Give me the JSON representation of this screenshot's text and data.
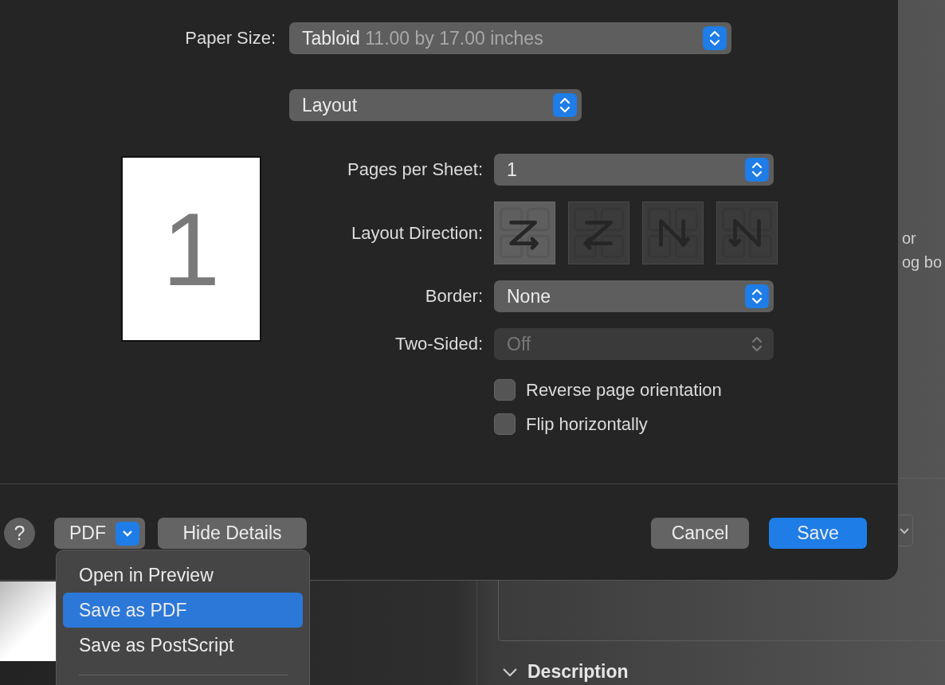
{
  "background_window": {
    "text_lines": [
      "or",
      "og bo"
    ],
    "section": {
      "label": "Description",
      "expanded": true
    }
  },
  "dialog": {
    "paper_size": {
      "label": "Paper Size:",
      "value": "Tabloid",
      "detail": "11.00 by 17.00 inches"
    },
    "section_popup": {
      "value": "Layout"
    },
    "preview": {
      "page_number": "1"
    },
    "fields": [
      {
        "kind": "popup",
        "label": "Pages per Sheet:",
        "value": "1",
        "disabled": false
      },
      {
        "kind": "direction",
        "label": "Layout Direction:",
        "options": [
          {
            "kind": "z",
            "selected": true
          },
          {
            "kind": "reverse-z",
            "selected": false
          },
          {
            "kind": "reverse-n",
            "selected": false
          },
          {
            "kind": "n",
            "selected": false
          }
        ]
      },
      {
        "kind": "popup",
        "label": "Border:",
        "value": "None",
        "disabled": false
      },
      {
        "kind": "popup",
        "label": "Two-Sided:",
        "value": "Off",
        "disabled": true
      }
    ],
    "checkboxes": [
      {
        "label": "Reverse page orientation",
        "checked": false
      },
      {
        "label": "Flip horizontally",
        "checked": false
      }
    ],
    "footer": {
      "help": "?",
      "pdf": "PDF",
      "hide_details": "Hide Details",
      "cancel": "Cancel",
      "save": "Save"
    },
    "pdf_menu": [
      {
        "label": "Open in Preview",
        "selected": false
      },
      {
        "label": "Save as PDF",
        "selected": true
      },
      {
        "label": "Save as PostScript",
        "selected": false
      }
    ]
  }
}
